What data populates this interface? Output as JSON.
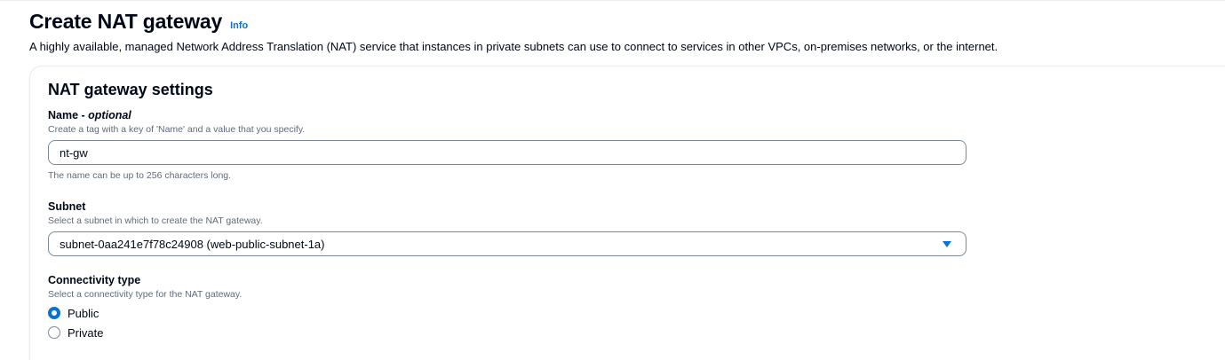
{
  "header": {
    "title": "Create NAT gateway",
    "info_label": "Info",
    "description": "A highly available, managed Network Address Translation (NAT) service that instances in private subnets can use to connect to services in other VPCs, on-premises networks, or the internet."
  },
  "settings": {
    "section_title": "NAT gateway settings",
    "name": {
      "label": "Name - ",
      "label_optional": "optional",
      "description": "Create a tag with a key of 'Name' and a value that you specify.",
      "value": "nt-gw",
      "constraint": "The name can be up to 256 characters long."
    },
    "subnet": {
      "label": "Subnet",
      "description": "Select a subnet in which to create the NAT gateway.",
      "selected": "subnet-0aa241e7f78c24908 (web-public-subnet-1a)"
    },
    "connectivity": {
      "label": "Connectivity type",
      "description": "Select a connectivity type for the NAT gateway.",
      "options": [
        {
          "label": "Public",
          "checked": true
        },
        {
          "label": "Private",
          "checked": false
        }
      ]
    }
  },
  "colors": {
    "accent": "#0972d3",
    "text": "#000716",
    "secondary_text": "#5f6b7a",
    "border": "#7d8998"
  }
}
